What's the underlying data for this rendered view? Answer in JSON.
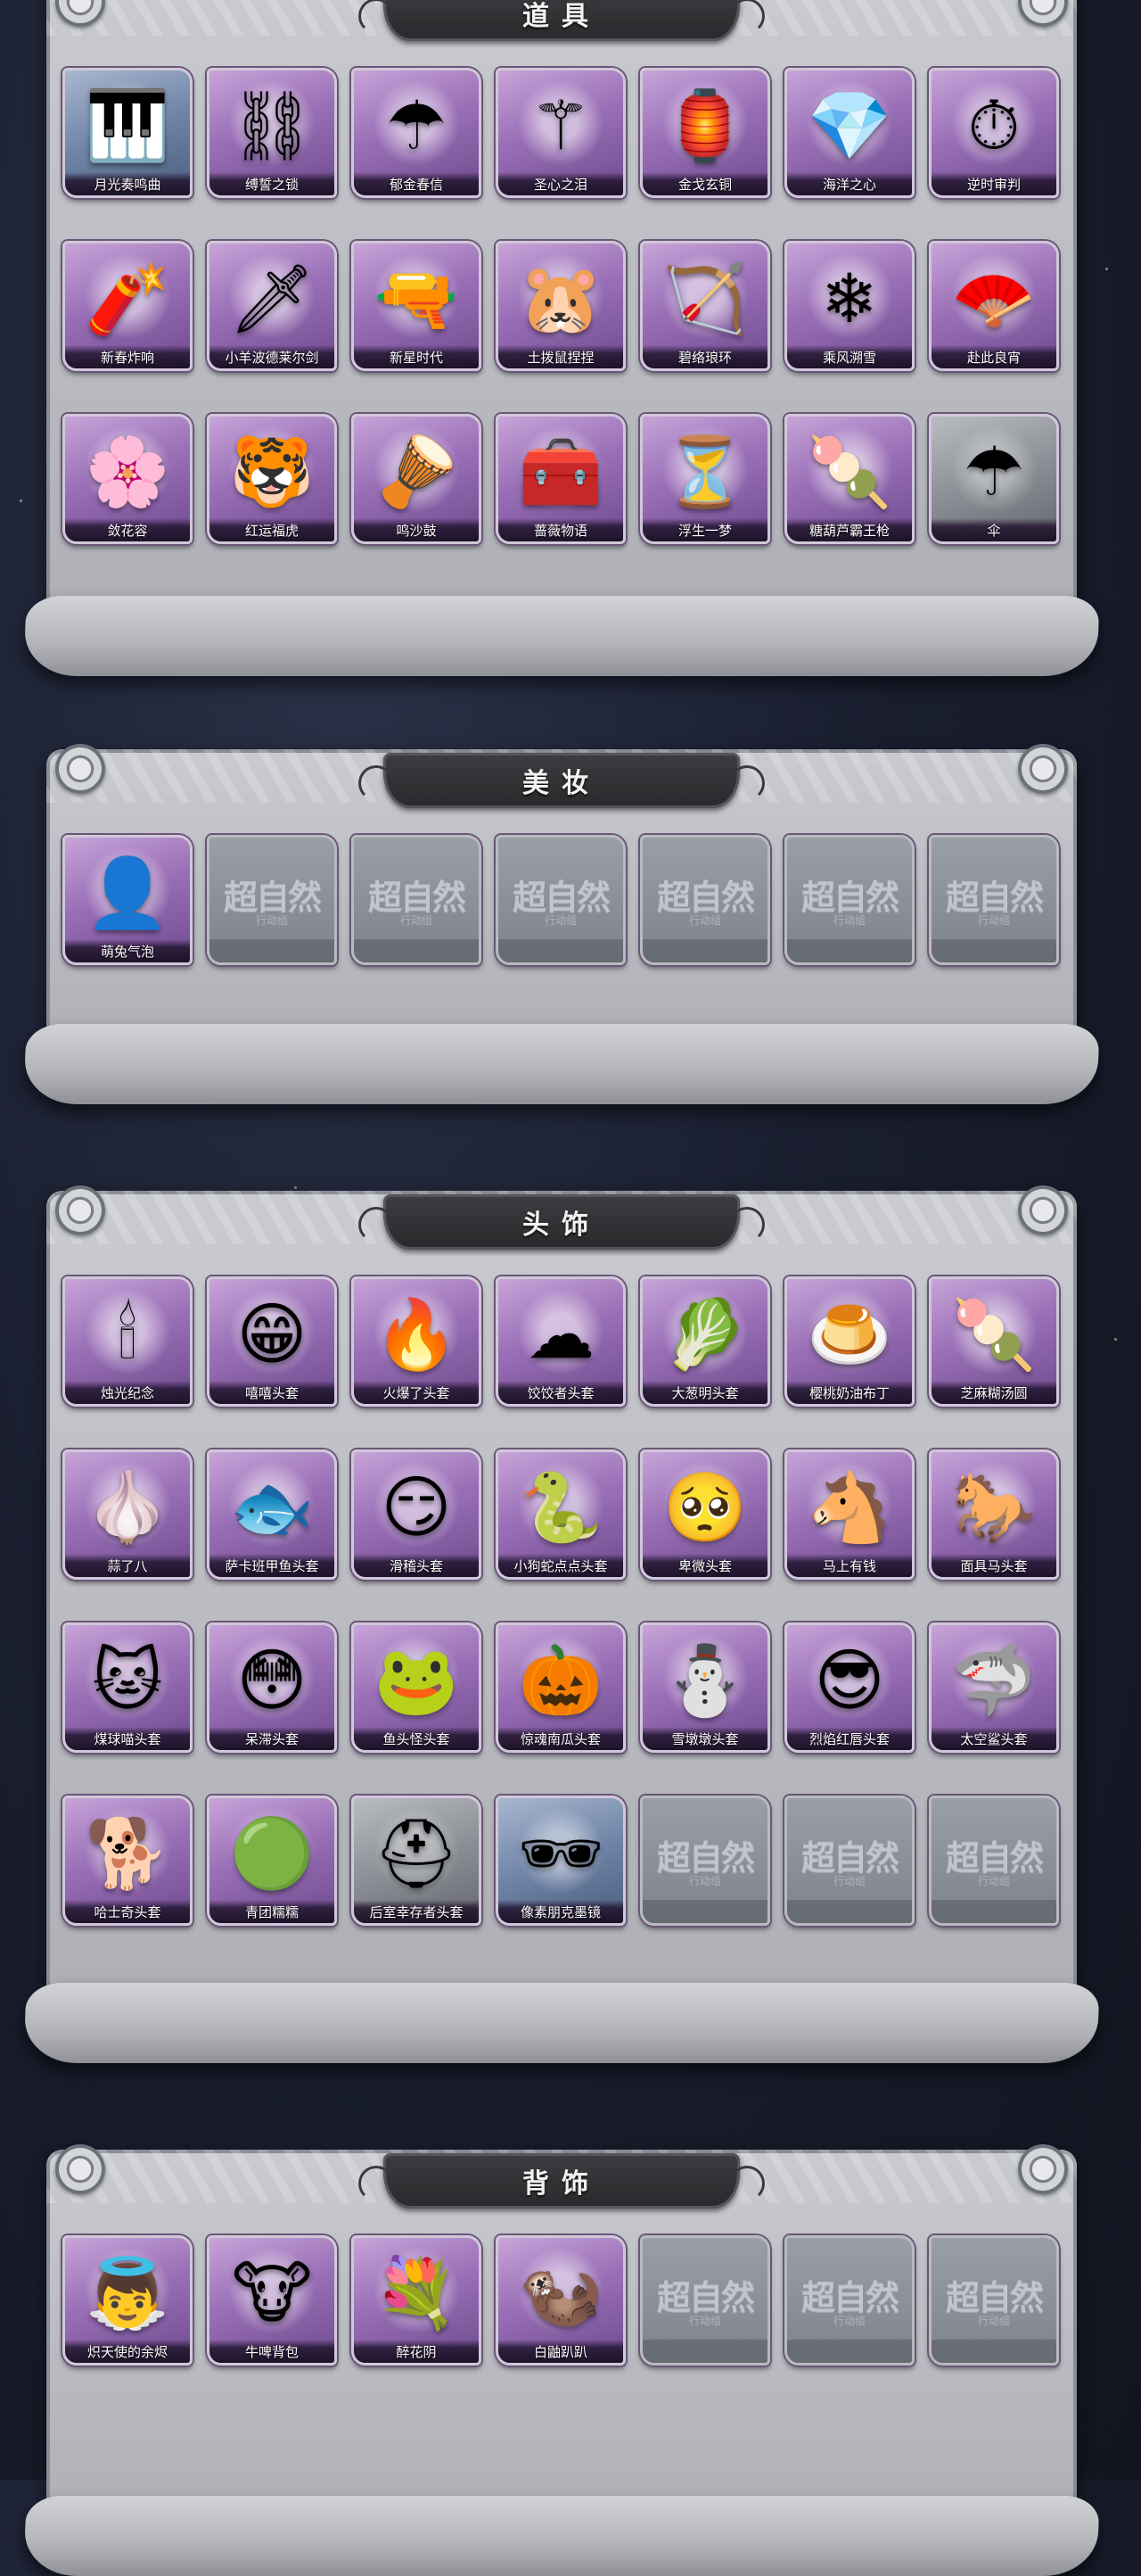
{
  "sections": [
    {
      "title": "道具",
      "items": [
        {
          "label": "月光奏鸣曲",
          "icon": "piano-icon",
          "glyph": "🎹",
          "tint": "blue"
        },
        {
          "label": "缚誓之锁",
          "icon": "chain-lock-icon",
          "glyph": "⛓",
          "tint": "purple"
        },
        {
          "label": "郁金春信",
          "icon": "umbrella-icon",
          "glyph": "☂",
          "tint": "purple"
        },
        {
          "label": "圣心之泪",
          "icon": "scepter-icon",
          "glyph": "⚚",
          "tint": "purple"
        },
        {
          "label": "金戈玄铜",
          "icon": "lantern-icon",
          "glyph": "🏮",
          "tint": "purple"
        },
        {
          "label": "海洋之心",
          "icon": "heart-necklace-icon",
          "glyph": "💎",
          "tint": "purple"
        },
        {
          "label": "逆时审判",
          "icon": "pocket-watch-icon",
          "glyph": "⏱",
          "tint": "purple"
        },
        {
          "label": "新春炸响",
          "icon": "firecracker-icon",
          "glyph": "🧨",
          "tint": "purple"
        },
        {
          "label": "小羊波德莱尔剑",
          "icon": "sword-icon",
          "glyph": "🗡",
          "tint": "purple"
        },
        {
          "label": "新星时代",
          "icon": "revolver-icon",
          "glyph": "🔫",
          "tint": "purple"
        },
        {
          "label": "土拨鼠捏捏",
          "icon": "groundhog-toy-icon",
          "glyph": "🐹",
          "tint": "purple"
        },
        {
          "label": "碧络琅环",
          "icon": "bow-icon",
          "glyph": "🏹",
          "tint": "purple"
        },
        {
          "label": "乘风溯雪",
          "icon": "jet-pack-icon",
          "glyph": "❄",
          "tint": "purple"
        },
        {
          "label": "赴此良宵",
          "icon": "fan-icon",
          "glyph": "🪭",
          "tint": "purple"
        },
        {
          "label": "敛花容",
          "icon": "flower-chain-icon",
          "glyph": "🌸",
          "tint": "purple"
        },
        {
          "label": "红运福虎",
          "icon": "tiger-icon",
          "glyph": "🐯",
          "tint": "purple"
        },
        {
          "label": "鸣沙鼓",
          "icon": "drum-ornament-icon",
          "glyph": "🪘",
          "tint": "purple"
        },
        {
          "label": "蔷薇物语",
          "icon": "first-aid-kit-icon",
          "glyph": "🧰",
          "tint": "purple"
        },
        {
          "label": "浮生一梦",
          "icon": "hourglass-icon",
          "glyph": "⏳",
          "tint": "purple"
        },
        {
          "label": "糖葫芦霸王枪",
          "icon": "spear-icon",
          "glyph": "🍡",
          "tint": "purple"
        },
        {
          "label": "伞",
          "icon": "parasol-icon",
          "glyph": "☂",
          "tint": "gray"
        }
      ]
    },
    {
      "title": "美妆",
      "items": [
        {
          "label": "萌兔气泡",
          "icon": "bunny-makeup-icon",
          "glyph": "👤",
          "tint": "purple"
        },
        {
          "empty": true
        },
        {
          "empty": true
        },
        {
          "empty": true
        },
        {
          "empty": true
        },
        {
          "empty": true
        },
        {
          "empty": true
        }
      ]
    },
    {
      "title": "头饰",
      "items": [
        {
          "label": "烛光纪念",
          "icon": "candle-icon",
          "glyph": "🕯",
          "tint": "purple"
        },
        {
          "label": "嘻嘻头套",
          "icon": "grin-face-icon",
          "glyph": "😁",
          "tint": "purple"
        },
        {
          "label": "火爆了头套",
          "icon": "fire-face-icon",
          "glyph": "🔥",
          "tint": "purple"
        },
        {
          "label": "饺饺者头套",
          "icon": "dumpling-icon",
          "glyph": "☁",
          "tint": "purple"
        },
        {
          "label": "大葱明头套",
          "icon": "leek-icon",
          "glyph": "🥬",
          "tint": "purple"
        },
        {
          "label": "樱桃奶油布丁",
          "icon": "pudding-icon",
          "glyph": "🍮",
          "tint": "purple"
        },
        {
          "label": "芝麻糊汤圆",
          "icon": "tangyuan-icon",
          "glyph": "🍡",
          "tint": "purple"
        },
        {
          "label": "蒜了八",
          "icon": "garlic-icon",
          "glyph": "🧄",
          "tint": "purple"
        },
        {
          "label": "萨卡班甲鱼头套",
          "icon": "fish-head-icon",
          "glyph": "🐟",
          "tint": "purple"
        },
        {
          "label": "滑稽头套",
          "icon": "smirk-face-icon",
          "glyph": "😏",
          "tint": "purple"
        },
        {
          "label": "小狗蛇点点头套",
          "icon": "snake-dog-icon",
          "glyph": "🐍",
          "tint": "purple"
        },
        {
          "label": "卑微头套",
          "icon": "humble-face-icon",
          "glyph": "🥺",
          "tint": "purple"
        },
        {
          "label": "马上有钱",
          "icon": "horse-cartoon-icon",
          "glyph": "🐴",
          "tint": "purple"
        },
        {
          "label": "面具马头套",
          "icon": "horse-mask-icon",
          "glyph": "🐎",
          "tint": "purple"
        },
        {
          "label": "煤球喵头套",
          "icon": "cat-head-icon",
          "glyph": "🐱",
          "tint": "purple"
        },
        {
          "label": "呆滞头套",
          "icon": "dazed-face-icon",
          "glyph": "😳",
          "tint": "purple"
        },
        {
          "label": "鱼头怪头套",
          "icon": "fish-monster-icon",
          "glyph": "🐸",
          "tint": "purple"
        },
        {
          "label": "惊魂南瓜头套",
          "icon": "pumpkin-icon",
          "glyph": "🎃",
          "tint": "purple"
        },
        {
          "label": "雪墩墩头套",
          "icon": "snowman-icon",
          "glyph": "⛄",
          "tint": "purple"
        },
        {
          "label": "烈焰红唇头套",
          "icon": "pikachu-sunglasses-icon",
          "glyph": "😎",
          "tint": "purple"
        },
        {
          "label": "太空鲨头套",
          "icon": "shark-icon",
          "glyph": "🦈",
          "tint": "purple"
        },
        {
          "label": "哈士奇头套",
          "icon": "husky-icon",
          "glyph": "🐕",
          "tint": "purple"
        },
        {
          "label": "青团糯糯",
          "icon": "green-dumpling-icon",
          "glyph": "🟢",
          "tint": "purple"
        },
        {
          "label": "后室幸存者头套",
          "icon": "gas-mask-icon",
          "glyph": "⛑",
          "tint": "gray"
        },
        {
          "label": "像素朋克墨镜",
          "icon": "pixel-sunglasses-icon",
          "glyph": "🕶",
          "tint": "blue"
        },
        {
          "empty": true
        },
        {
          "empty": true
        },
        {
          "empty": true
        }
      ]
    },
    {
      "title": "背饰",
      "items": [
        {
          "label": "炽天使的余烬",
          "icon": "angel-doll-icon",
          "glyph": "👼",
          "tint": "purple"
        },
        {
          "label": "牛啤背包",
          "icon": "cow-barrel-icon",
          "glyph": "🐮",
          "tint": "purple"
        },
        {
          "label": "醉花阴",
          "icon": "flower-crown-icon",
          "glyph": "💐",
          "tint": "purple"
        },
        {
          "label": "白鼬趴趴",
          "icon": "ferret-icon",
          "glyph": "🦦",
          "tint": "purple"
        },
        {
          "empty": true
        },
        {
          "empty": true
        },
        {
          "empty": true
        }
      ]
    }
  ],
  "empty_slot": {
    "watermark": "超自然",
    "sub": "行动组"
  }
}
